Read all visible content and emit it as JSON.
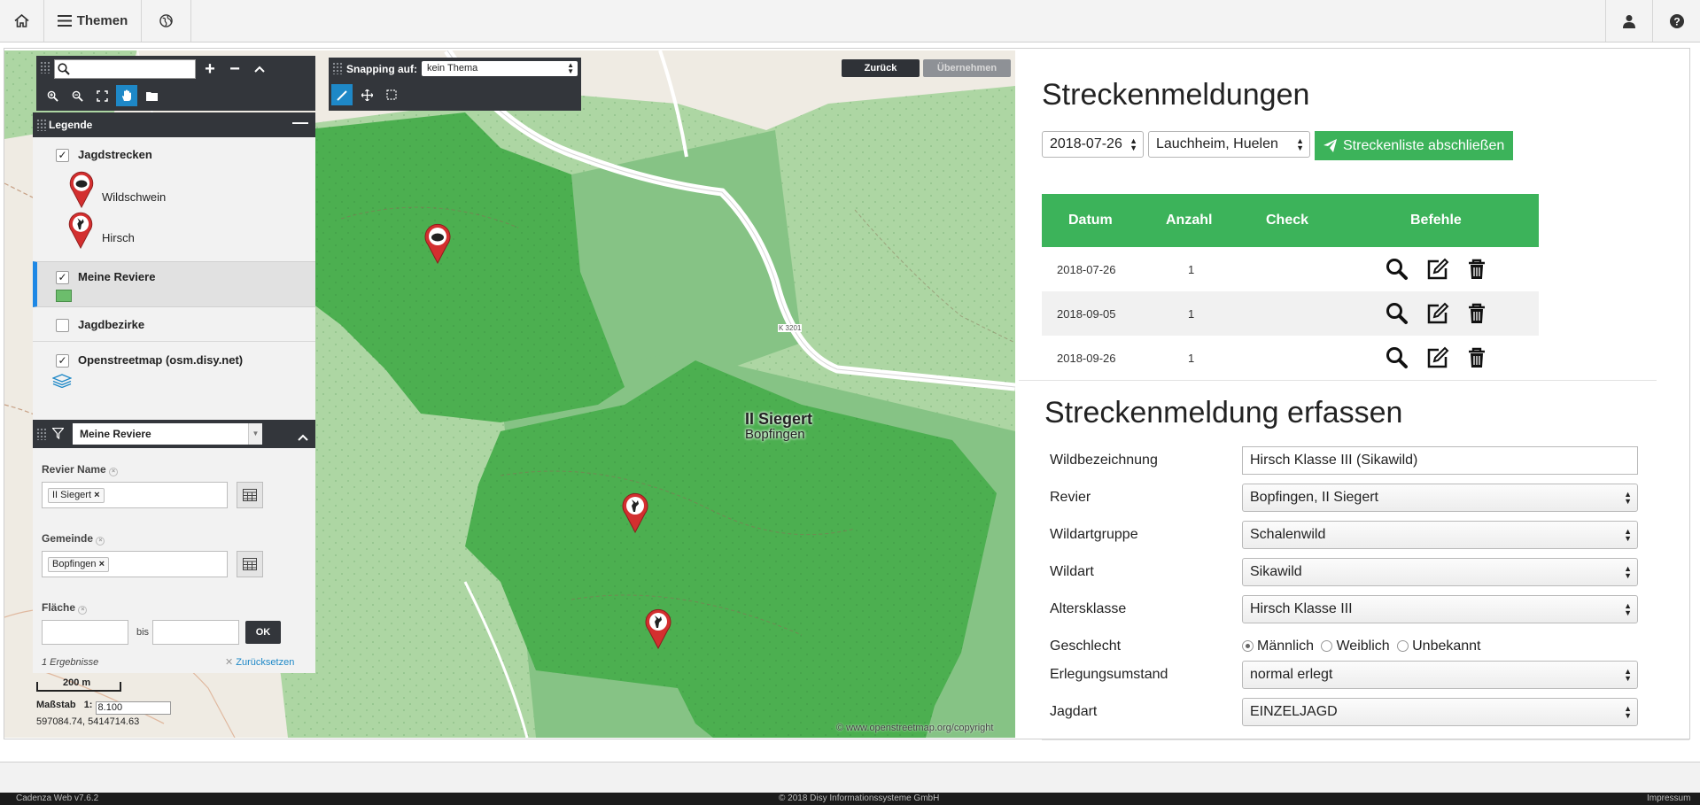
{
  "topbar": {
    "home_icon": "home-icon",
    "themes_label": "Themen",
    "globe_icon": "globe-icon",
    "user_icon": "user-icon",
    "help_icon": "help-icon"
  },
  "map": {
    "search_placeholder": "",
    "snapping_label": "Snapping auf:",
    "snapping_value": "kein Thema",
    "back_button": "Zurück",
    "apply_button": "Übernehmen",
    "place_name": "II Siegert",
    "place_sub": "Bopfingen",
    "road_label": "K 3201",
    "copyright": "© www.openstreetmap.org/copyright",
    "scale_bar_label": "200 m",
    "scale_label": "Maßstab",
    "scale_prefix": "1:",
    "scale_value": "8.100",
    "coordinates": "597084.74, 5414714.63",
    "legend": {
      "title": "Legende",
      "groups": [
        {
          "label": "Jagdstrecken",
          "checked": true
        },
        {
          "label": "Meine Reviere",
          "checked": true
        },
        {
          "label": "Jagdbezirke",
          "checked": false
        },
        {
          "label": "Openstreetmap (osm.disy.net)",
          "checked": true
        }
      ],
      "symbols": [
        "Wildschwein",
        "Hirsch"
      ],
      "checkmark": "✓"
    },
    "filter": {
      "layer_value": "Meine Reviere",
      "revier_label": "Revier Name",
      "revier_tag": "II Siegert",
      "gemeinde_label": "Gemeinde",
      "gemeinde_tag": "Bopfingen",
      "flaeche_label": "Fläche",
      "bis_label": "bis",
      "ok_label": "OK",
      "results": "1 Ergebnisse",
      "reset_label": "Zurücksetzen",
      "tag_remove": "×"
    }
  },
  "right": {
    "title": "Streckenmeldungen",
    "date_value": "2018-07-26",
    "location_value": "Lauchheim, Huelen",
    "close_list_button": "Streckenliste abschließen",
    "table": {
      "headers": [
        "Datum",
        "Anzahl",
        "Check",
        "Befehle"
      ],
      "rows": [
        {
          "datum": "2018-07-26",
          "anzahl": "1"
        },
        {
          "datum": "2018-09-05",
          "anzahl": "1"
        },
        {
          "datum": "2018-09-26",
          "anzahl": "1"
        }
      ]
    },
    "form_title": "Streckenmeldung erfassen",
    "form": {
      "wildbezeichnung_label": "Wildbezeichnung",
      "wildbezeichnung_value": "Hirsch Klasse III (Sikawild)",
      "revier_label": "Revier",
      "revier_value": "Bopfingen, II Siegert",
      "wildartgruppe_label": "Wildartgruppe",
      "wildartgruppe_value": "Schalenwild",
      "wildart_label": "Wildart",
      "wildart_value": "Sikawild",
      "altersklasse_label": "Altersklasse",
      "altersklasse_value": "Hirsch Klasse III",
      "geschlecht_label": "Geschlecht",
      "geschlecht_options": [
        "Männlich",
        "Weiblich",
        "Unbekannt"
      ],
      "geschlecht_selected": "Männlich",
      "erlegungsumstand_label": "Erlegungsumstand",
      "erlegungsumstand_value": "normal erlegt",
      "jagdart_label": "Jagdart",
      "jagdart_value": "EINZELJAGD"
    }
  },
  "footer": {
    "version": "Cadenza Web v7.6.2",
    "copyright": "© 2018 Disy Informationssysteme GmbH",
    "impressum": "Impressum"
  },
  "colors": {
    "accent_green": "#3cb35a",
    "map_area_green": "#4caf50",
    "topbar_bg": "#f3f3f3",
    "footer_bg": "#1b1b1b"
  }
}
